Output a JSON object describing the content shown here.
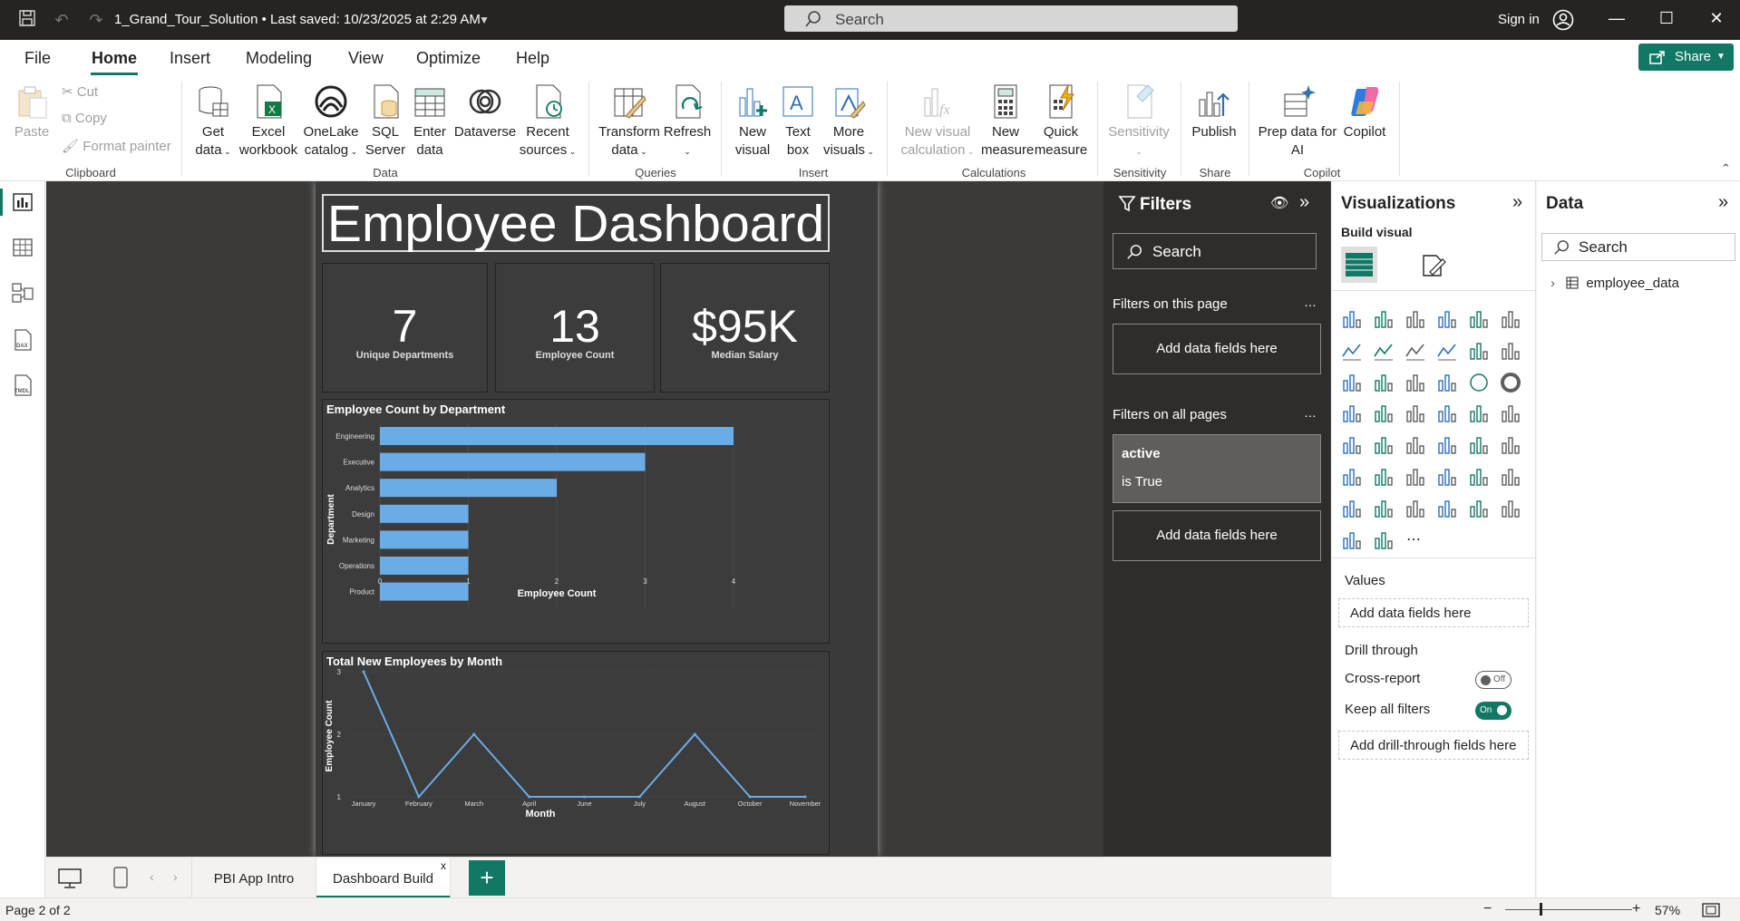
{
  "titlebar": {
    "doc_title": "1_Grand_Tour_Solution • Last saved: 10/23/2025 at 2:29 AM",
    "search_placeholder": "Search",
    "sign_in": "Sign in"
  },
  "menu": {
    "tabs": [
      "File",
      "Home",
      "Insert",
      "Modeling",
      "View",
      "Optimize",
      "Help"
    ],
    "active": "Home",
    "share_label": "Share"
  },
  "ribbon": {
    "clipboard": {
      "paste": "Paste",
      "cut": "Cut",
      "copy": "Copy",
      "format_painter": "Format painter",
      "group": "Clipboard"
    },
    "data": {
      "get_data": [
        "Get",
        "data"
      ],
      "excel": [
        "Excel",
        "workbook"
      ],
      "onelake": [
        "OneLake",
        "catalog"
      ],
      "sql": [
        "SQL",
        "Server"
      ],
      "enter": [
        "Enter",
        "data"
      ],
      "dataverse": [
        "Dataverse",
        ""
      ],
      "recent": [
        "Recent",
        "sources"
      ],
      "group": "Data"
    },
    "queries": {
      "transform": [
        "Transform",
        "data"
      ],
      "refresh": [
        "Refresh",
        ""
      ],
      "group": "Queries"
    },
    "insert": {
      "new_visual": [
        "New",
        "visual"
      ],
      "text_box": [
        "Text",
        "box"
      ],
      "more_visuals": [
        "More",
        "visuals"
      ],
      "group": "Insert"
    },
    "calculations": {
      "new_visual_calc": [
        "New visual",
        "calculation"
      ],
      "new_measure": [
        "New",
        "measure"
      ],
      "quick_measure": [
        "Quick",
        "measure"
      ],
      "group": "Calculations"
    },
    "sensitivity": {
      "label": "Sensitivity",
      "group": "Sensitivity"
    },
    "share": {
      "publish": "Publish",
      "group": "Share"
    },
    "copilot": {
      "prep": [
        "Prep data for",
        "AI"
      ],
      "copilot": "Copilot",
      "group": "Copilot"
    }
  },
  "report": {
    "title": "Employee Dashboard",
    "cards": [
      {
        "value": "7",
        "label": "Unique Departments"
      },
      {
        "value": "13",
        "label": "Employee Count"
      },
      {
        "value": "$95K",
        "label": "Median Salary"
      }
    ]
  },
  "chart_data": [
    {
      "type": "bar",
      "title": "Employee Count by Department",
      "categories": [
        "Engineering",
        "Executive",
        "Analytics",
        "Design",
        "Marketing",
        "Operations",
        "Product"
      ],
      "values": [
        4,
        3,
        2,
        1,
        1,
        1,
        1
      ],
      "xlabel": "Employee Count",
      "ylabel": "Department",
      "xlim": [
        0,
        4
      ],
      "xticks": [
        "0",
        "1",
        "2",
        "3",
        "4"
      ],
      "color": "#6aace6"
    },
    {
      "type": "line",
      "title": "Total New Employees by Month",
      "categories": [
        "January",
        "February",
        "March",
        "April",
        "June",
        "July",
        "August",
        "October",
        "November"
      ],
      "values": [
        3,
        1,
        2,
        1,
        1,
        1,
        2,
        1,
        1
      ],
      "xlabel": "Month",
      "ylabel": "Employee Count",
      "ylim": [
        1,
        3
      ],
      "yticks": [
        "1",
        "2",
        "3"
      ],
      "color": "#6aace6"
    }
  ],
  "filters": {
    "title": "Filters",
    "search": "Search",
    "on_this_page": "Filters on this page",
    "add_fields": "Add data fields here",
    "on_all_pages": "Filters on all pages",
    "active_field": "active",
    "active_condition": "is True",
    "add_fields_2": "Add data fields here"
  },
  "visualizations": {
    "title": "Visualizations",
    "build_visual": "Build visual",
    "values_label": "Values",
    "values_placeholder": "Add data fields here",
    "drill_through": "Drill through",
    "cross_report": "Cross-report",
    "cross_report_state": "Off",
    "keep_all_filters": "Keep all filters",
    "keep_all_state": "On",
    "drill_placeholder": "Add drill-through fields here"
  },
  "data_pane": {
    "title": "Data",
    "search": "Search",
    "table": "employee_data"
  },
  "pages": {
    "tabs": [
      "PBI App Intro",
      "Dashboard Build"
    ],
    "active": "Dashboard Build",
    "status": "Page 2 of 2",
    "zoom": "57%"
  }
}
